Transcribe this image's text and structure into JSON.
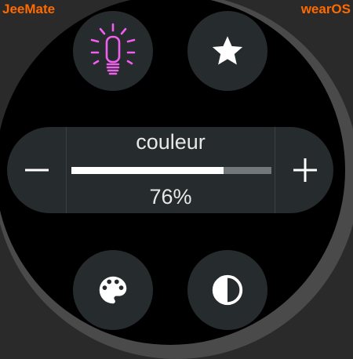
{
  "brand": {
    "left_label": "JeeMate",
    "right_label": "wearOS",
    "color": "#ff6a00"
  },
  "buttons": {
    "light": {
      "icon": "light-bulb-icon",
      "color": "#f25ff0"
    },
    "favorite": {
      "icon": "star-icon"
    },
    "palette": {
      "icon": "palette-icon"
    },
    "contrast": {
      "icon": "contrast-icon"
    }
  },
  "control": {
    "label": "couleur",
    "value_text": "76%",
    "level": 0.76,
    "decrement_icon": "minus-icon",
    "increment_icon": "plus-icon"
  }
}
